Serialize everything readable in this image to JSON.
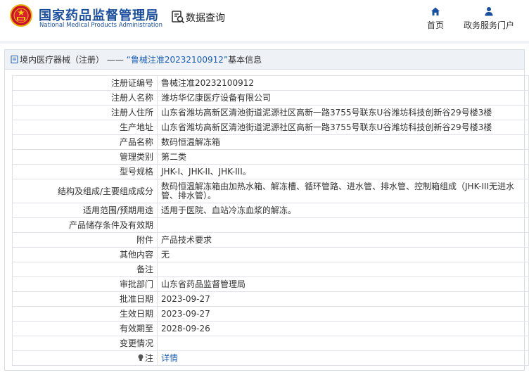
{
  "header": {
    "brand_cn": "国家药品监督管理局",
    "brand_en": "National Medical Products Administration",
    "query_label": "数据查询",
    "nav": [
      {
        "label": "首页",
        "icon": "home-icon"
      },
      {
        "label": "政务服务门户",
        "icon": "user-icon"
      }
    ],
    "brand_color": "#1a4fa0"
  },
  "panel": {
    "title_prefix": "境内医疗器械（注册）",
    "title_sep": " —— ",
    "title_link": "“鲁械注准20232100912”",
    "title_suffix": "基本信息"
  },
  "rows": [
    {
      "key": "注册证编号",
      "value": "鲁械注准20232100912"
    },
    {
      "key": "注册人名称",
      "value": "潍坊华亿康医疗设备有限公司"
    },
    {
      "key": "注册人住所",
      "value": "山东省潍坊高新区清池街道泥源社区高新一路3755号联东U谷潍坊科技创新谷29号楼3楼"
    },
    {
      "key": "生产地址",
      "value": "山东省潍坊高新区清池街道泥源社区高新一路3755号联东U谷潍坊科技创新谷29号楼3楼"
    },
    {
      "key": "产品名称",
      "value": "数码恒温解冻箱"
    },
    {
      "key": "管理类别",
      "value": "第二类"
    },
    {
      "key": "型号规格",
      "value": "JHK-I、JHK-II、JHK-III。"
    },
    {
      "key": "结构及组成/主要组成成分",
      "value": "数码恒温解冻箱由加热水箱、解冻槽、循环管路、进水管、排水管、控制箱组成（JHK-III无进水管、排水管）。"
    },
    {
      "key": "适用范围/预期用途",
      "value": "适用于医院、血站冷冻血浆的解冻。"
    },
    {
      "key": "产品储存条件及有效期",
      "value": ""
    },
    {
      "key": "附件",
      "value": "产品技术要求"
    },
    {
      "key": "其他内容",
      "value": "无"
    },
    {
      "key": "备注",
      "value": ""
    },
    {
      "key": "审批部门",
      "value": "山东省药品监督管理局"
    },
    {
      "key": "批准日期",
      "value": "2023-09-27"
    },
    {
      "key": "生效日期",
      "value": "2023-09-27"
    },
    {
      "key": "有效期至",
      "value": "2028-09-26"
    },
    {
      "key": "变更情况",
      "value": ""
    },
    {
      "key": "注",
      "value": "详情"
    }
  ]
}
